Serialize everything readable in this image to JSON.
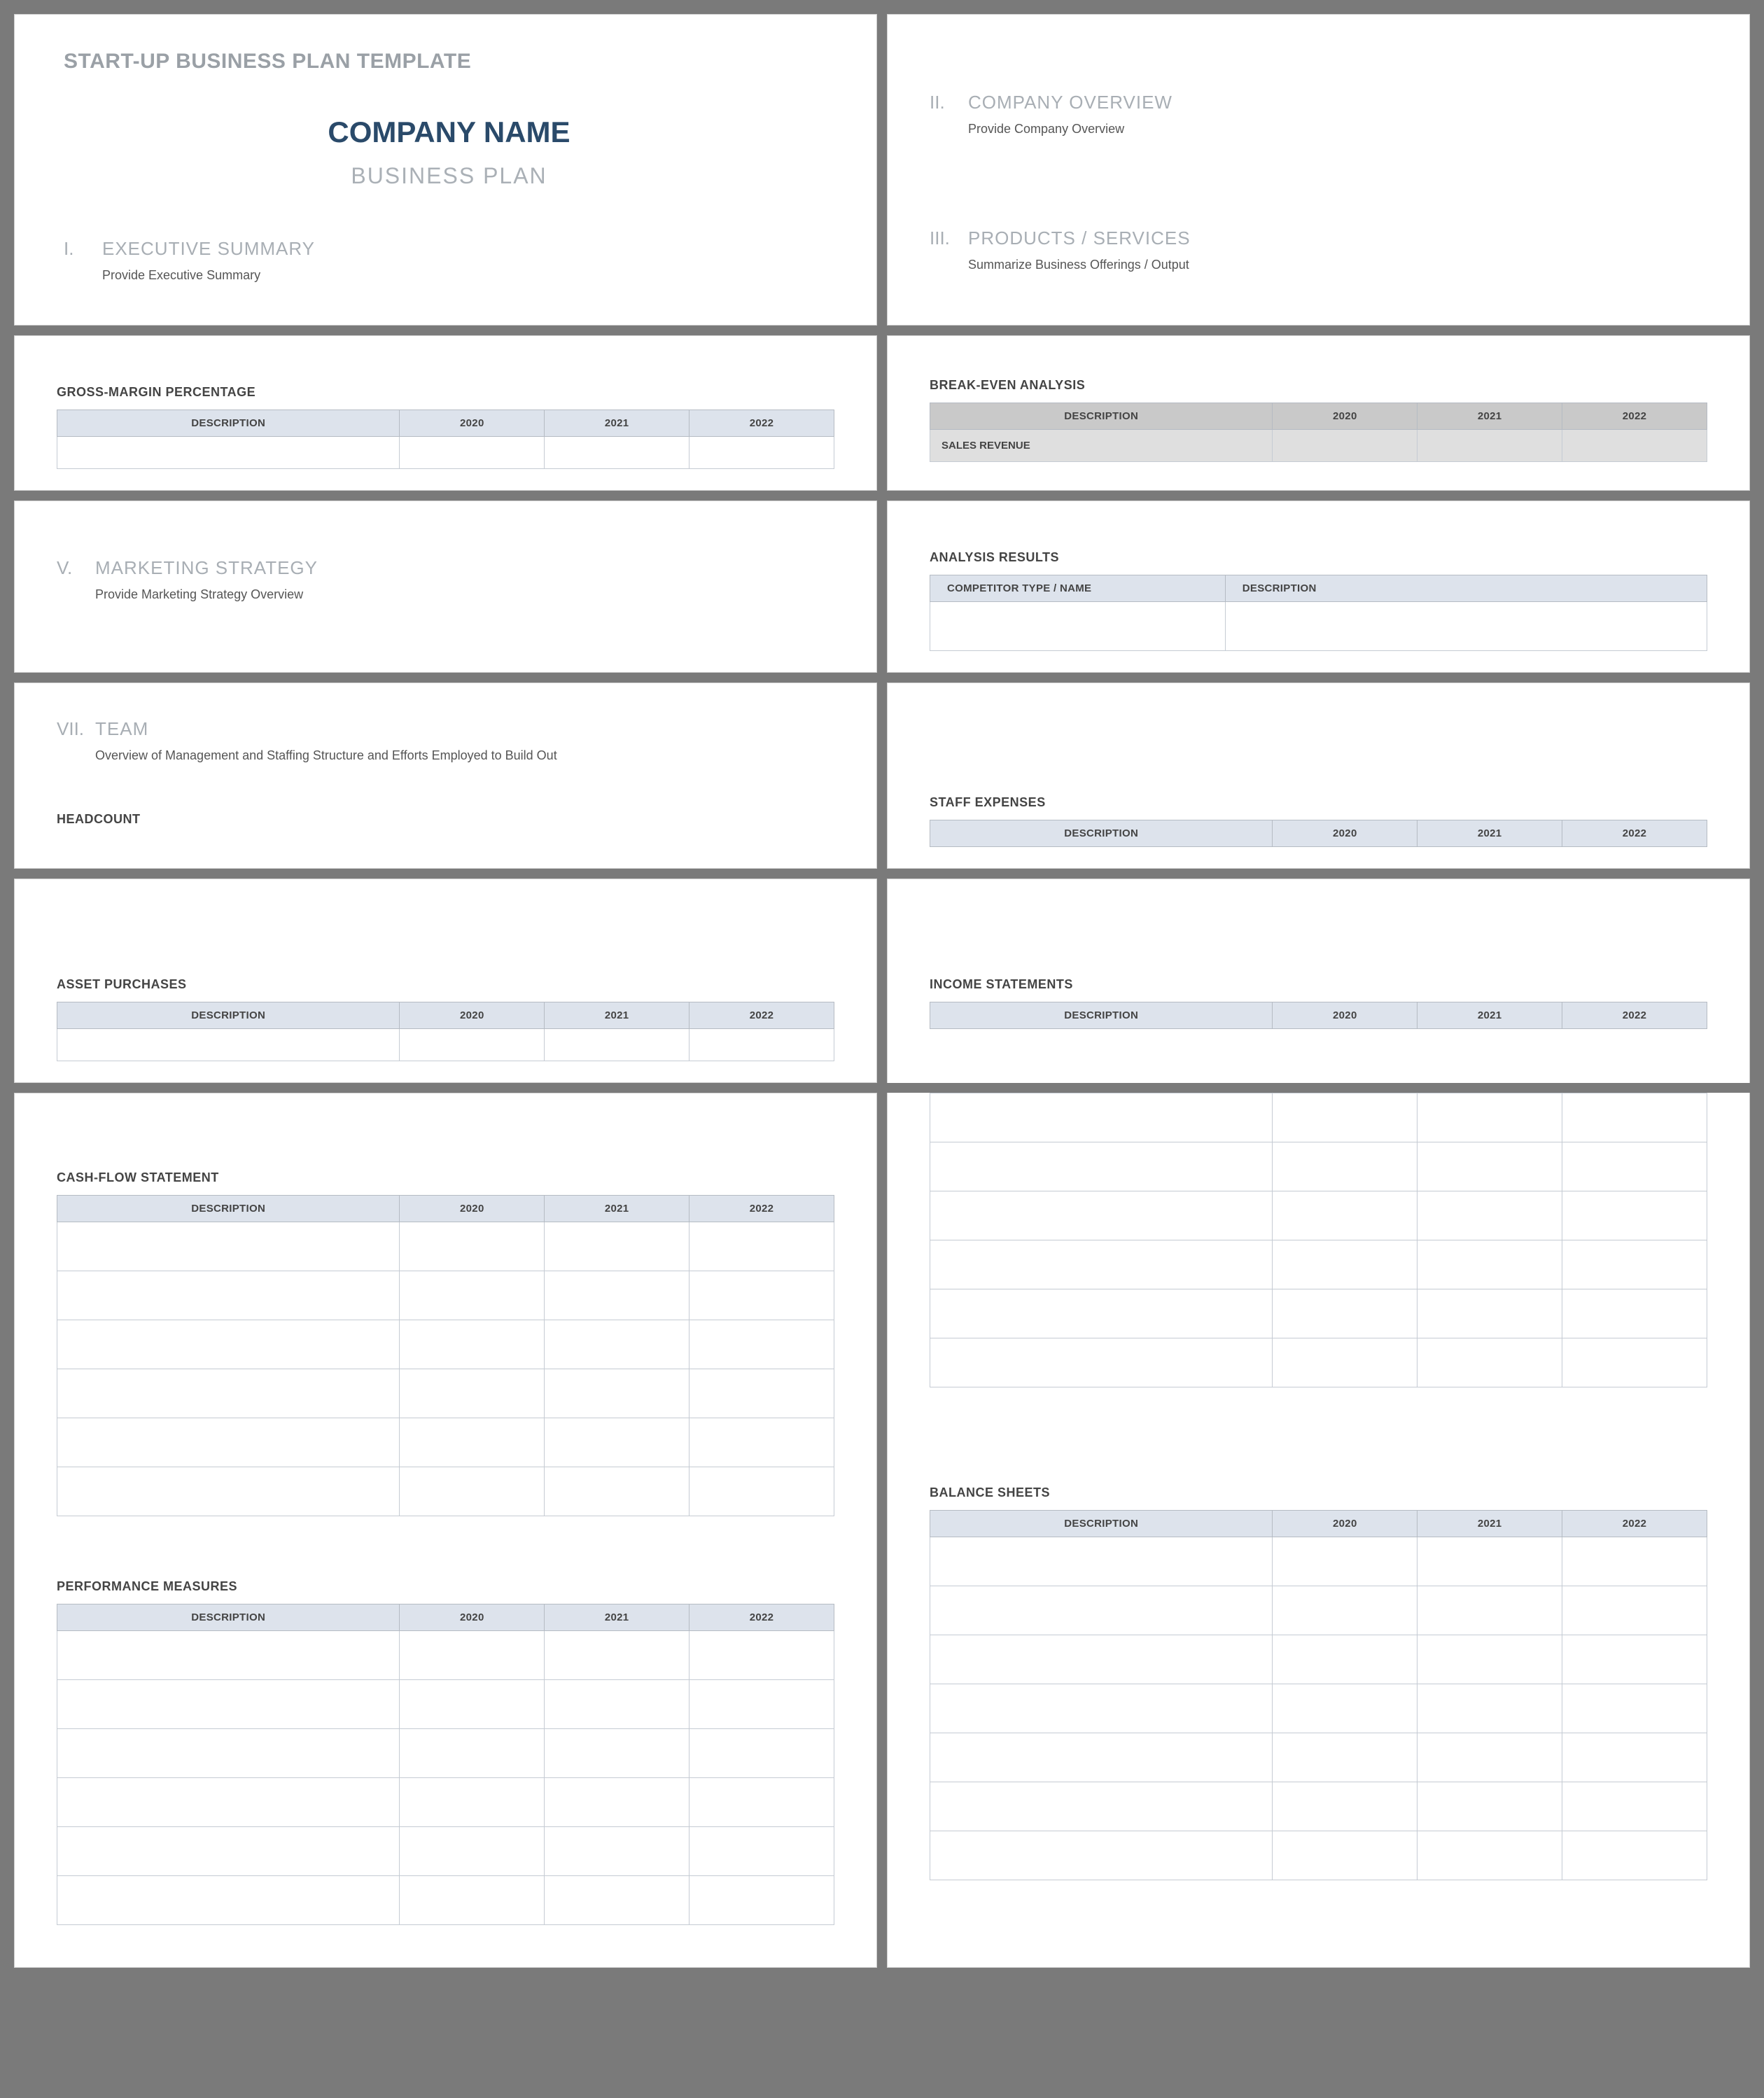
{
  "doc_title": "START-UP BUSINESS PLAN TEMPLATE",
  "company_name": "COMPANY NAME",
  "subtitle": "BUSINESS PLAN",
  "sections": {
    "exec": {
      "roman": "I.",
      "title": "EXECUTIVE SUMMARY",
      "body": "Provide Executive Summary"
    },
    "over": {
      "roman": "II.",
      "title": "COMPANY OVERVIEW",
      "body": "Provide Company Overview"
    },
    "prod": {
      "roman": "III.",
      "title": "PRODUCTS / SERVICES",
      "body": "Summarize Business Offerings / Output"
    },
    "mkt": {
      "roman": "V.",
      "title": "MARKETING STRATEGY",
      "body": "Provide Marketing Strategy Overview"
    },
    "team": {
      "roman": "VII.",
      "title": "TEAM",
      "body": "Overview of Management and Staffing Structure and Efforts Employed to Build Out"
    }
  },
  "blocks": {
    "gross": "GROSS-MARGIN PERCENTAGE",
    "break": "BREAK-EVEN ANALYSIS",
    "analysis": "ANALYSIS RESULTS",
    "head": "HEADCOUNT",
    "staff": "STAFF EXPENSES",
    "asset": "ASSET PURCHASES",
    "income": "INCOME STATEMENTS",
    "cash": "CASH-FLOW STATEMENT",
    "perf": "PERFORMANCE MEASURES",
    "balance": "BALANCE SHEETS"
  },
  "cols": {
    "desc": "DESCRIPTION",
    "y1": "2020",
    "y2": "2021",
    "y3": "2022",
    "comp": "COMPETITOR TYPE / NAME"
  },
  "rows": {
    "sales_rev": "SALES REVENUE"
  }
}
